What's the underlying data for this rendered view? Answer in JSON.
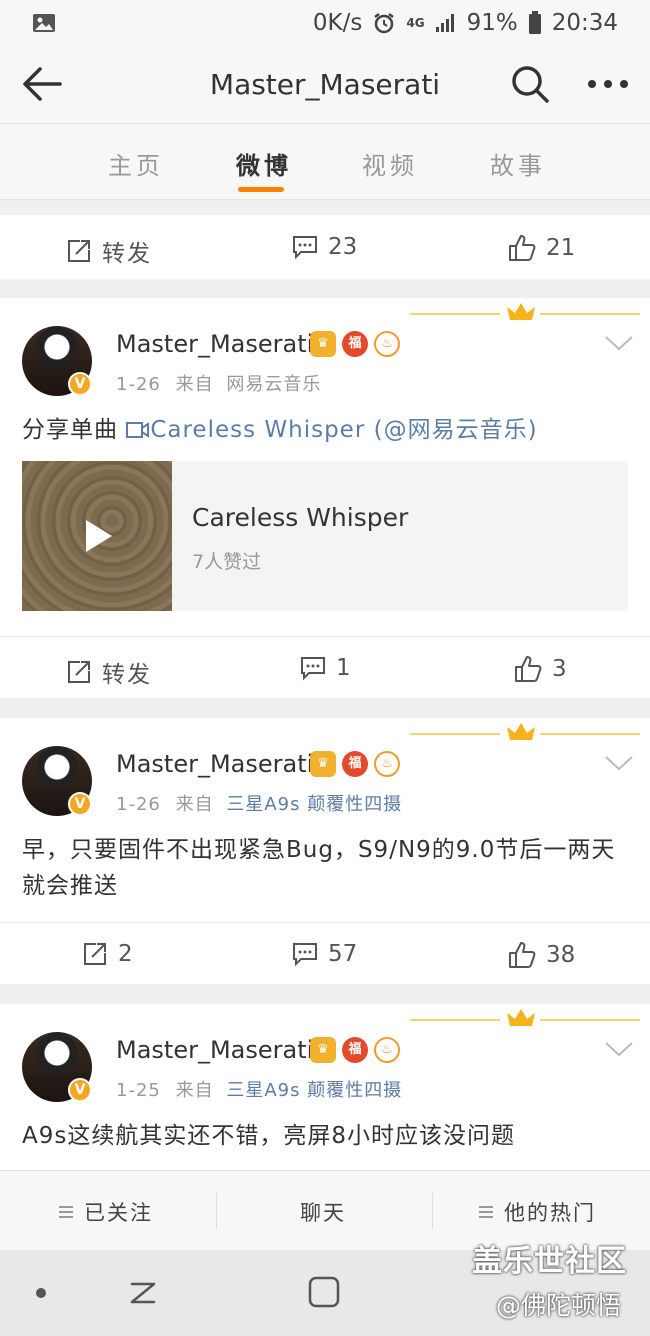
{
  "status_bar": {
    "net_speed": "0K/s",
    "network": "4G",
    "battery": "91%",
    "time": "20:34"
  },
  "header": {
    "title": "Master_Maserati"
  },
  "tabs": [
    {
      "label": "主页"
    },
    {
      "label": "微博",
      "active": true
    },
    {
      "label": "视频"
    },
    {
      "label": "故事"
    }
  ],
  "top_actions": {
    "repost": "转发",
    "comments": "23",
    "likes": "21"
  },
  "posts": [
    {
      "username": "Master_Maserati",
      "date": "1-26",
      "from_label": "来自",
      "source": "网易云音乐",
      "text_prefix": "分享单曲 ",
      "link_text": "Careless Whisper",
      "text_suffix": " (@网易云音乐)",
      "music": {
        "title": "Careless Whisper",
        "likes": "7人赞过"
      },
      "actions": {
        "repost": "转发",
        "comments": "1",
        "likes": "3"
      }
    },
    {
      "username": "Master_Maserati",
      "date": "1-26",
      "from_label": "来自",
      "source": "三星A9s 颠覆性四摄",
      "text": "早，只要固件不出现紧急Bug，S9/N9的9.0节后一两天就会推送",
      "actions": {
        "repost": "2",
        "comments": "57",
        "likes": "38"
      }
    },
    {
      "username": "Master_Maserati",
      "date": "1-25",
      "from_label": "来自",
      "source": "三星A9s 颠覆性四摄",
      "text": "A9s这续航其实还不错，亮屏8小时应该没问题"
    }
  ],
  "bottom_bar": {
    "following": "已关注",
    "chat": "聊天",
    "hot": "他的热门"
  },
  "watermark": {
    "line1": "盖乐世社区",
    "line2": "@佛陀顿悟"
  },
  "colors": {
    "accent": "#ff8200",
    "link": "#5b7da8",
    "verified": "#f5a623"
  }
}
